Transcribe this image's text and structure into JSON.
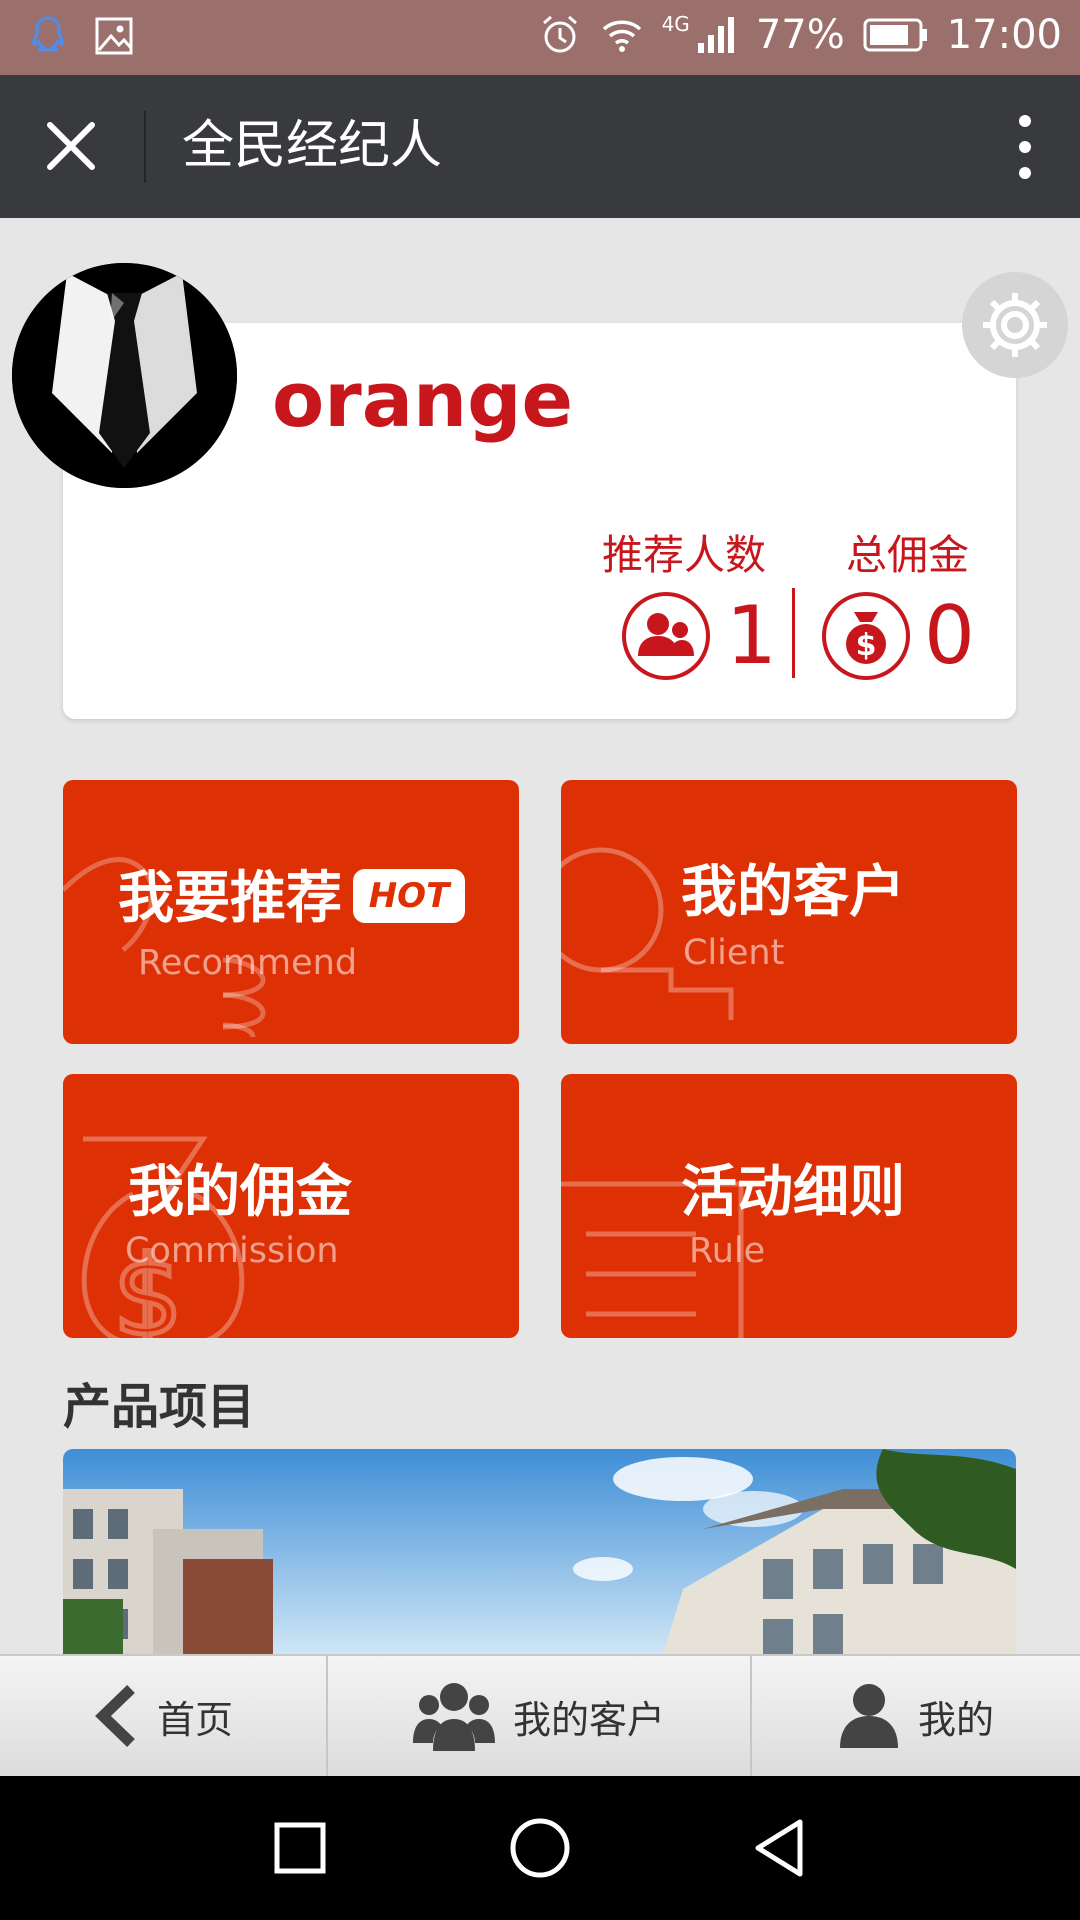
{
  "status_bar": {
    "icons_left": [
      "qq-icon",
      "image-icon"
    ],
    "icons_right": [
      "alarm-icon",
      "wifi-icon",
      "signal-icon",
      "battery-icon"
    ],
    "network": "4G",
    "battery": "77%",
    "time": "17:00"
  },
  "app_bar": {
    "title": "全民经纪人",
    "close_icon": "close-icon",
    "menu_icon": "more-vertical-icon"
  },
  "profile": {
    "username": "orange",
    "avatar_icon": "suit-tie-avatar",
    "settings_icon": "gear-icon",
    "stats": [
      {
        "label": "推荐人数",
        "value": "1",
        "icon": "users-icon"
      },
      {
        "label": "总佣金",
        "value": "0",
        "icon": "money-bag-icon"
      }
    ]
  },
  "tiles": [
    {
      "title": "我要推荐",
      "subtitle": "Recommend",
      "badge": "HOT"
    },
    {
      "title": "我的客户",
      "subtitle": "Client"
    },
    {
      "title": "我的佣金",
      "subtitle": "Commission"
    },
    {
      "title": "活动细则",
      "subtitle": "Rule"
    }
  ],
  "section": {
    "title": "产品项目"
  },
  "tab_bar": {
    "tabs": [
      {
        "label": "首页",
        "icon": "chevron-left-icon"
      },
      {
        "label": "我的客户",
        "icon": "group-icon"
      },
      {
        "label": "我的",
        "icon": "user-icon"
      }
    ]
  },
  "colors": {
    "accent": "#dd3004",
    "brand_text": "#c8161d",
    "title_bar": "#393a3e",
    "status_bar": "#9a6f6c",
    "background": "#e6e6e6"
  }
}
